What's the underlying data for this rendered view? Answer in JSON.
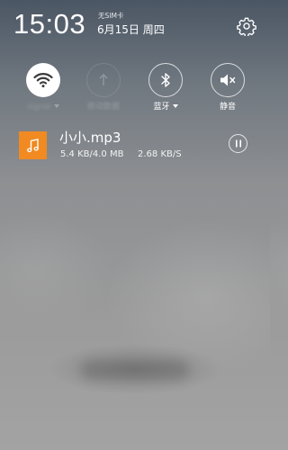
{
  "status": {
    "time": "15:03",
    "sim": "无SIM卡",
    "date": "6月15日 周四"
  },
  "toggles": [
    {
      "name": "wifi",
      "label": "signal",
      "state": "on",
      "icon": "wifi-icon"
    },
    {
      "name": "hotspot",
      "label": "移动数据",
      "state": "disabled",
      "icon": "hotspot-icon"
    },
    {
      "name": "bluetooth",
      "label": "蓝牙",
      "state": "off",
      "icon": "bluetooth-icon"
    },
    {
      "name": "mute",
      "label": "静音",
      "state": "off",
      "icon": "mute-icon"
    }
  ],
  "notification": {
    "title": "小小.mp3",
    "size": "5.4 KB/4.0 MB",
    "speed": "2.68 KB/S",
    "app_icon": "music-note-icon",
    "app_color": "#f08a21",
    "action_icon": "pause-icon"
  }
}
